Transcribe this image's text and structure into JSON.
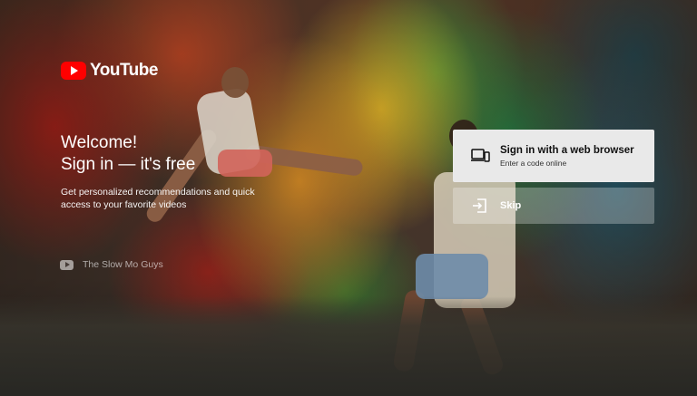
{
  "app": {
    "logo_text": "YouTube",
    "brand_color": "#ff0000"
  },
  "welcome": {
    "line1": "Welcome!",
    "line2": "Sign in — it's free",
    "description": "Get personalized recommendations and quick access to your favorite videos"
  },
  "channel": {
    "name": "The Slow Mo Guys",
    "icon": "youtube-play-icon"
  },
  "actions": {
    "sign_in": {
      "label": "Sign in with a web browser",
      "sublabel": "Enter a code online",
      "icon": "devices-icon"
    },
    "skip": {
      "label": "Skip",
      "icon": "exit-arrow-icon"
    }
  },
  "colors": {
    "primary_button_bg": "#e9e9e9",
    "text_light": "#ffffff"
  }
}
